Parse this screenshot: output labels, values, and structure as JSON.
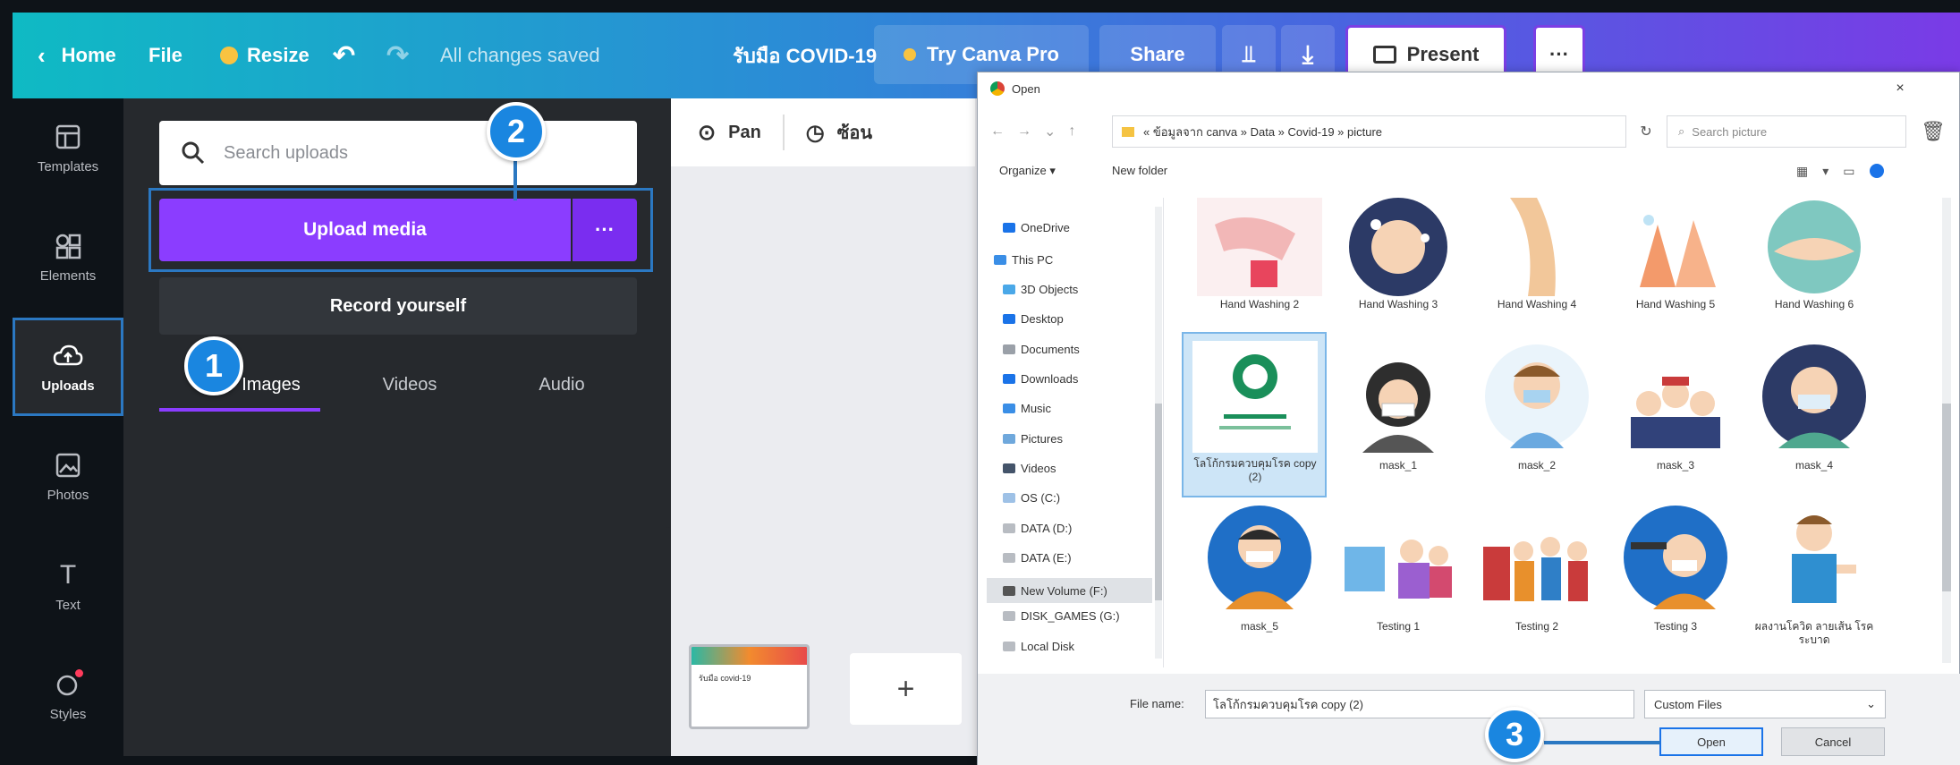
{
  "topbar": {
    "home": "Home",
    "file": "File",
    "resize": "Resize",
    "saved_status": "All changes saved",
    "doc_title": "รับมือ COVID-19",
    "try_pro": "Try Canva Pro",
    "share": "Share",
    "present": "Present",
    "more": "···"
  },
  "rail": {
    "items": [
      {
        "label": "Templates",
        "icon": "template-icon"
      },
      {
        "label": "Elements",
        "icon": "elements-icon"
      },
      {
        "label": "Uploads",
        "icon": "upload-cloud-icon"
      },
      {
        "label": "Photos",
        "icon": "photo-icon"
      },
      {
        "label": "Text",
        "icon": "text-icon"
      },
      {
        "label": "Styles",
        "icon": "styles-icon"
      }
    ]
  },
  "panel": {
    "search_placeholder": "Search uploads",
    "upload_button": "Upload media",
    "upload_more": "···",
    "record_button": "Record yourself",
    "tabs": [
      "Images",
      "Videos",
      "Audio"
    ]
  },
  "canvas": {
    "tool1": "Pan",
    "tool2": "ซ้อน",
    "page_thumb_text": "รับมือ covid-19",
    "add_page": "+"
  },
  "dialog": {
    "title": "Open",
    "address": "« ข้อมูลจาก canva » Data » Covid-19 » picture",
    "search_placeholder": "Search picture",
    "organize": "Organize ▾",
    "new_folder": "New folder",
    "nav": [
      "OneDrive",
      "This PC",
      "3D Objects",
      "Desktop",
      "Documents",
      "Downloads",
      "Music",
      "Pictures",
      "Videos",
      "OS (C:)",
      "DATA (D:)",
      "DATA (E:)",
      "New Volume (F:)",
      "DISK_GAMES (G:)",
      "Local Disk"
    ],
    "files": [
      "Hand Washing 2",
      "Hand Washing 3",
      "Hand Washing 4",
      "Hand Washing 5",
      "Hand Washing 6",
      "โลโก้กรมควบคุมโรค copy (2)",
      "mask_1",
      "mask_2",
      "mask_3",
      "mask_4",
      "mask_5",
      "Testing 1",
      "Testing 2",
      "Testing 3",
      "ผลงานโควิด ลายเส้น โรคระบาด"
    ],
    "filename_label": "File name:",
    "filename_value": "โลโก้กรมควบคุมโรค copy (2)",
    "filetype": "Custom Files",
    "open_button": "Open",
    "cancel_button": "Cancel"
  },
  "callouts": [
    "1",
    "2",
    "3"
  ],
  "colors": {
    "accent_purple": "#8b3dff",
    "callout_blue": "#1a86e0",
    "highlight_blue": "#2b78c2"
  }
}
